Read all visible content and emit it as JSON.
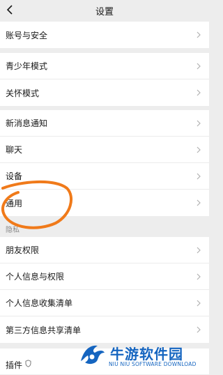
{
  "header": {
    "title": "设置"
  },
  "groups": [
    {
      "items": [
        {
          "label": "账号与安全"
        }
      ]
    },
    {
      "items": [
        {
          "label": "青少年模式"
        },
        {
          "label": "关怀模式"
        }
      ]
    },
    {
      "items": [
        {
          "label": "新消息通知"
        },
        {
          "label": "聊天"
        },
        {
          "label": "设备"
        },
        {
          "label": "通用"
        }
      ]
    },
    {
      "header": "隐私",
      "items": [
        {
          "label": "朋友权限"
        },
        {
          "label": "个人信息与权限"
        },
        {
          "label": "个人信息收集清单"
        },
        {
          "label": "第三方信息共享清单"
        }
      ]
    }
  ],
  "plugins": {
    "label": "插件"
  },
  "watermark": {
    "title": "牛游软件园",
    "subtitle": "NIU NIU SOFTWARE DOWNLOAD"
  },
  "colors": {
    "background": "#ededed",
    "row": "#ffffff",
    "annotation": "#f07a1a",
    "watermark": "#1565c0"
  },
  "icons": {
    "back": "chevron-left-icon",
    "row_arrow": "chevron-right-icon",
    "plugin": "shield-icon"
  }
}
